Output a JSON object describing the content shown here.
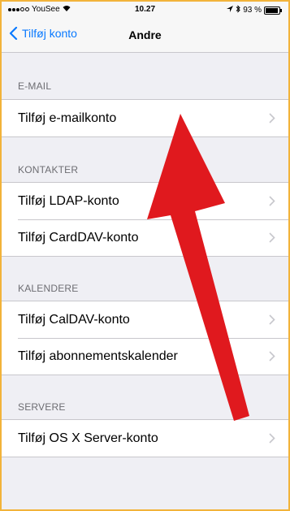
{
  "status_bar": {
    "carrier": "YouSee",
    "time": "10.27",
    "battery": "93 %",
    "battery_level": 0.93,
    "icons": [
      "signal-icon",
      "wifi-icon",
      "location-icon",
      "bluetooth-icon",
      "battery-icon"
    ]
  },
  "nav": {
    "back_label": "Tilføj konto",
    "title": "Andre"
  },
  "sections": [
    {
      "header": "E-MAIL",
      "items": [
        "Tilføj e-mailkonto"
      ]
    },
    {
      "header": "KONTAKTER",
      "items": [
        "Tilføj LDAP-konto",
        "Tilføj CardDAV-konto"
      ]
    },
    {
      "header": "KALENDERE",
      "items": [
        "Tilføj CalDAV-konto",
        "Tilføj abonnementskalender"
      ]
    },
    {
      "header": "SERVERE",
      "items": [
        "Tilføj OS X Server-konto"
      ]
    }
  ],
  "colors": {
    "accent": "#0a7aff",
    "arrow": "#e0191e",
    "frame": "#f2b33a",
    "background": "#efeff4"
  }
}
